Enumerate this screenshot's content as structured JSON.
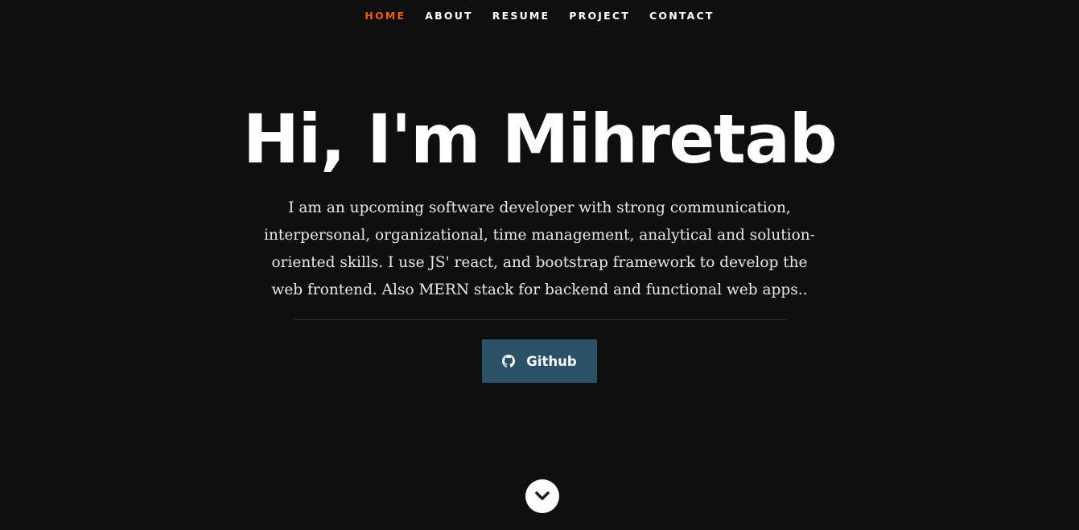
{
  "nav": {
    "items": [
      {
        "label": "HOME",
        "active": true
      },
      {
        "label": "ABOUT",
        "active": false
      },
      {
        "label": "RESUME",
        "active": false
      },
      {
        "label": "PROJECT",
        "active": false
      },
      {
        "label": "CONTACT",
        "active": false
      }
    ]
  },
  "hero": {
    "title": "Hi, I'm Mihretab",
    "description": "I am an upcoming software developer with strong communication, interpersonal, organizational, time management, analytical and solution-oriented skills. I use JS' react, and bootstrap framework to develop the web frontend. Also MERN stack for backend and functional web apps..",
    "github_button": {
      "label": "Github",
      "icon": "github-icon"
    }
  },
  "scroll_button": {
    "icon": "chevron-down-icon"
  },
  "colors": {
    "background": "#0f0f0f",
    "accent": "#F06000",
    "button": "#2B5167",
    "text": "#ffffff"
  }
}
